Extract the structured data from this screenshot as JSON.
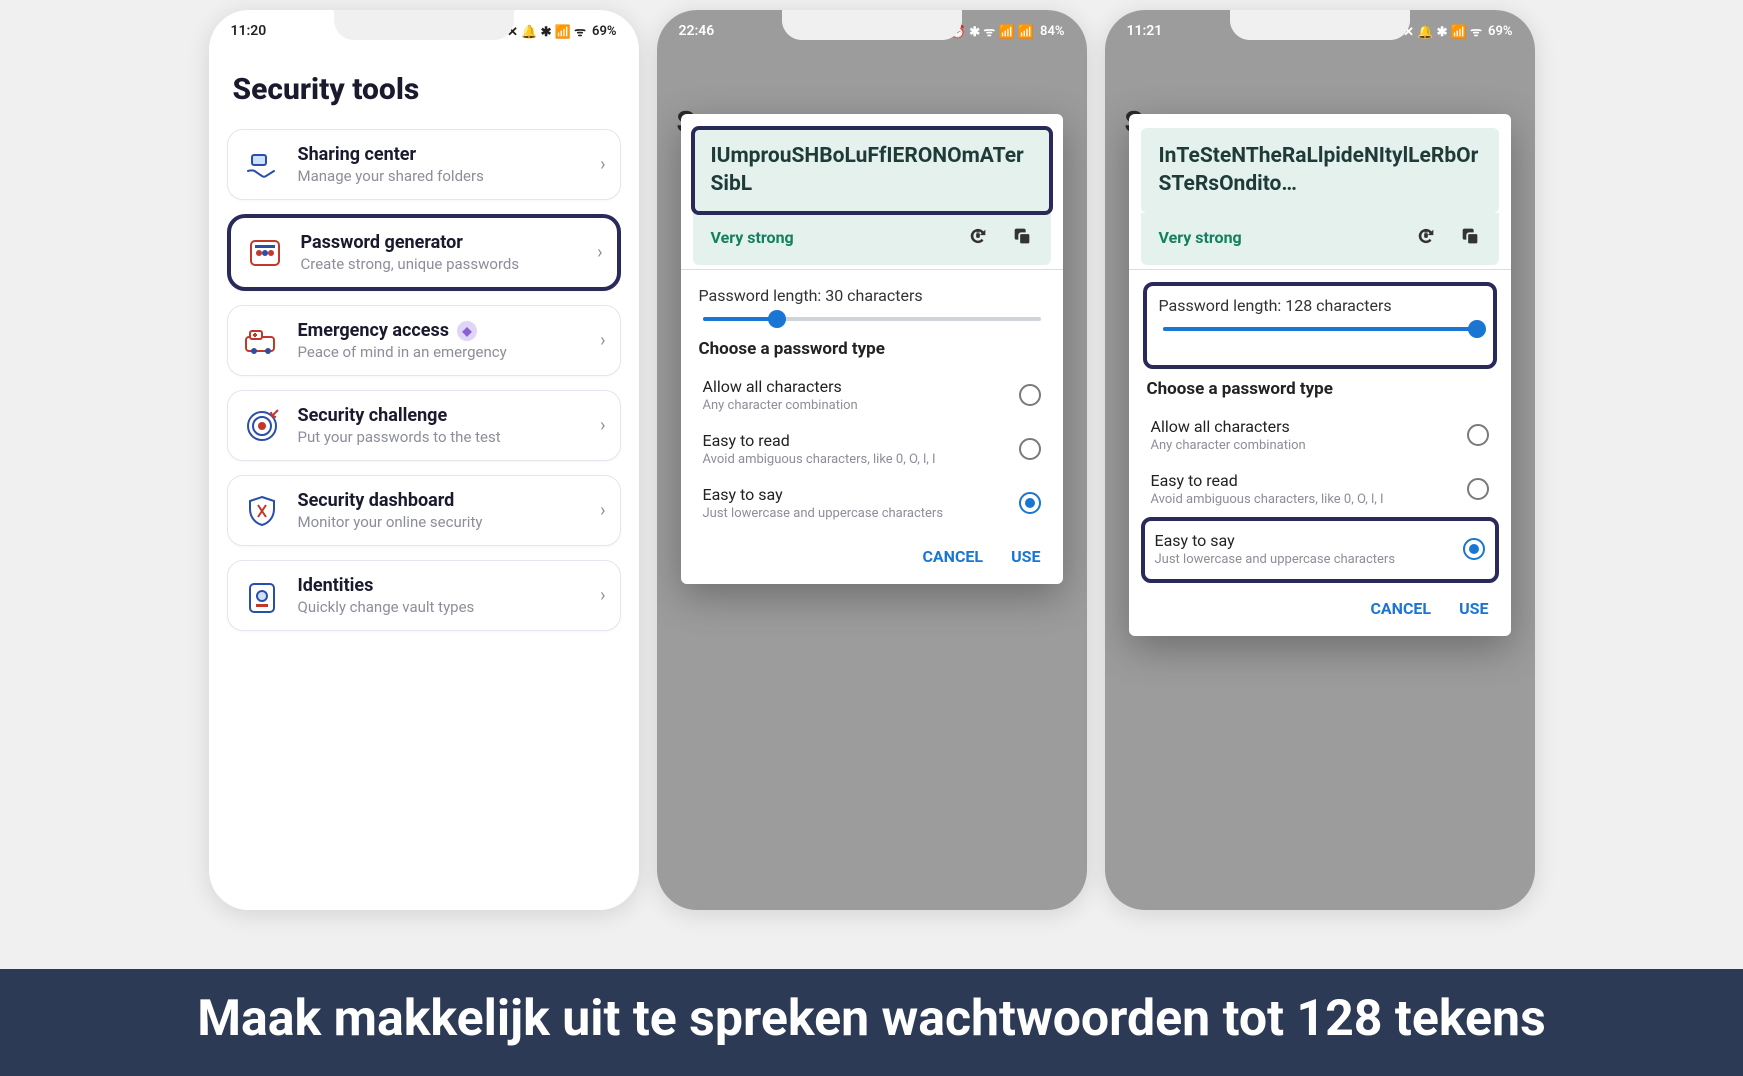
{
  "caption": "Maak makkelijk uit te spreken wachtwoorden tot 128 tekens",
  "colors": {
    "accent_blue": "#1976d2",
    "accent_green": "#13805f",
    "highlight_border": "#2a2a5a",
    "caption_bg": "#2d3a56"
  },
  "phones": {
    "a": {
      "status": {
        "time": "11:20",
        "battery": "69%",
        "icons": "🔔 ⚡ ✱ 📶 📶"
      },
      "title": "Security tools",
      "tools": [
        {
          "icon": "share-hands-icon",
          "title": "Sharing center",
          "sub": "Manage your shared folders"
        },
        {
          "icon": "password-generator-icon",
          "title": "Password generator",
          "sub": "Create strong, unique passwords",
          "highlighted": true
        },
        {
          "icon": "emergency-icon",
          "title": "Emergency access",
          "sub": "Peace of mind in an emergency",
          "badge": true
        },
        {
          "icon": "target-icon",
          "title": "Security challenge",
          "sub": "Put your passwords to the test"
        },
        {
          "icon": "shield-icon",
          "title": "Security dashboard",
          "sub": "Monitor your online security"
        },
        {
          "icon": "id-card-icon",
          "title": "Identities",
          "sub": "Quickly change vault types"
        }
      ]
    },
    "b": {
      "status": {
        "time": "22:46",
        "battery": "84%"
      },
      "peek_title": "S",
      "dialog": {
        "password": "IUmprouSHBoLuFfIERONOmATerSibL",
        "password_boxed": true,
        "strength": "Very strong",
        "length_label": "Password length: 30 characters",
        "slider_percent": 22,
        "length_boxed": false,
        "type_heading": "Choose a password type",
        "options": [
          {
            "title": "Allow all characters",
            "sub": "Any character combination",
            "checked": false,
            "boxed": false
          },
          {
            "title": "Easy to read",
            "sub": "Avoid ambiguous characters, like 0, O, l, I",
            "checked": false,
            "boxed": false
          },
          {
            "title": "Easy to say",
            "sub": "Just lowercase and uppercase characters",
            "checked": true,
            "boxed": false
          }
        ],
        "cancel": "CANCEL",
        "use": "USE"
      }
    },
    "c": {
      "status": {
        "time": "11:21",
        "battery": "69%"
      },
      "peek_title": "S",
      "dialog": {
        "password": "InTeSteNTheRaLlpideNItylLeRbOrSTeRsOndito…",
        "password_boxed": false,
        "strength": "Very strong",
        "length_label": "Password length: 128 characters",
        "slider_percent": 100,
        "length_boxed": true,
        "type_heading": "Choose a password type",
        "options": [
          {
            "title": "Allow all characters",
            "sub": "Any character combination",
            "checked": false,
            "boxed": false
          },
          {
            "title": "Easy to read",
            "sub": "Avoid ambiguous characters, like 0, O, l, I",
            "checked": false,
            "boxed": false
          },
          {
            "title": "Easy to say",
            "sub": "Just lowercase and uppercase characters",
            "checked": true,
            "boxed": true
          }
        ],
        "cancel": "CANCEL",
        "use": "USE"
      }
    }
  }
}
